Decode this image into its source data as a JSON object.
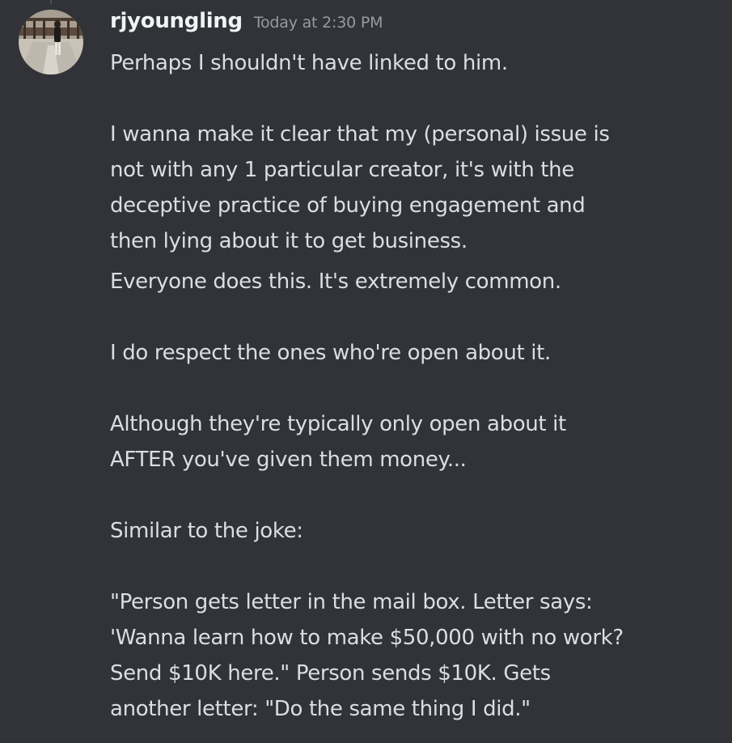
{
  "message": {
    "author": "rjyoungling",
    "timestamp": "Today at 2:30 PM",
    "avatar_icon": "user-avatar-photo",
    "lines": [
      "Perhaps I shouldn't have linked to him.",
      "I wanna make it clear that my (personal) issue is",
      "not with any 1 particular creator, it's with the",
      "deceptive practice of buying engagement and",
      "then lying about it to get business.",
      "Everyone does this. It's extremely common.",
      "I do respect the ones who're open about it.",
      "Although they're typically only open about it",
      "AFTER you've given them money...",
      "Similar to the joke:",
      "\"Person gets letter in the mail box. Letter says:",
      "'Wanna learn how to make $50,000 with no work?",
      "Send $10K here.\" Person sends $10K. Gets",
      "another letter: \"Do the same thing I did.\""
    ]
  },
  "colors": {
    "background": "#313338",
    "text": "#dbdee1",
    "username": "#f2f3f5",
    "timestamp": "#949ba4"
  }
}
